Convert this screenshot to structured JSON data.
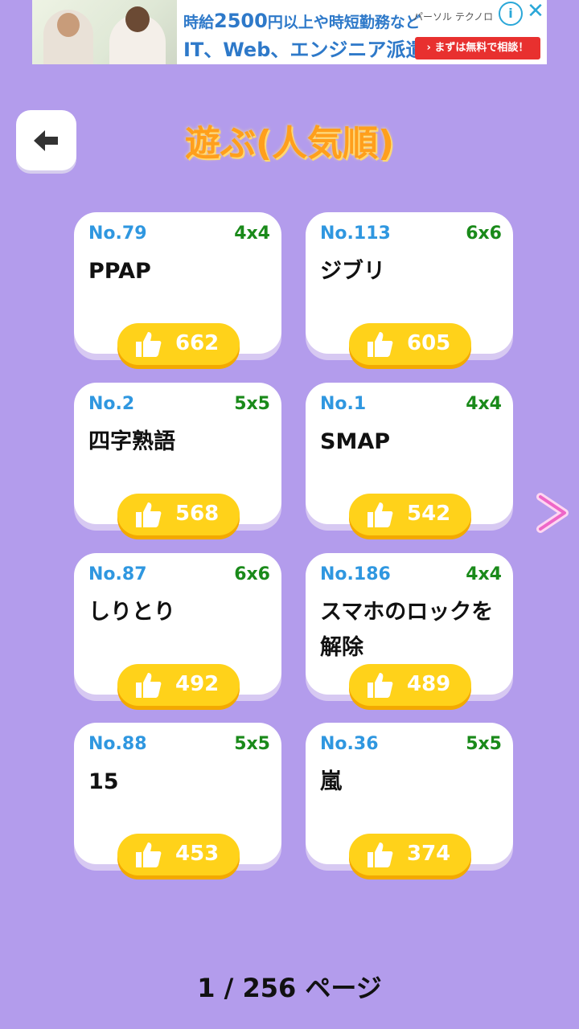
{
  "ad": {
    "line1_prefix": "時給",
    "line1_amount": "2500",
    "line1_suffix": "円以上や時短勤務など",
    "line2": "IT、Web、エンジニア派遣",
    "brand": "パーソル テクノロ",
    "cta": "› まずは無料で相談！",
    "info_icon": "i",
    "close_icon": "✕"
  },
  "header": {
    "title": "遊ぶ(人気順)"
  },
  "cards": [
    {
      "no": "No.79",
      "size": "4x4",
      "name": "PPAP",
      "likes": "662"
    },
    {
      "no": "No.113",
      "size": "6x6",
      "name": "ジブリ",
      "likes": "605"
    },
    {
      "no": "No.2",
      "size": "5x5",
      "name": "四字熟語",
      "likes": "568"
    },
    {
      "no": "No.1",
      "size": "4x4",
      "name": "SMAP",
      "likes": "542"
    },
    {
      "no": "No.87",
      "size": "6x6",
      "name": "しりとり",
      "likes": "492"
    },
    {
      "no": "No.186",
      "size": "4x4",
      "name": "スマホのロックを解除",
      "likes": "489"
    },
    {
      "no": "No.88",
      "size": "5x5",
      "name": "15",
      "likes": "453"
    },
    {
      "no": "No.36",
      "size": "5x5",
      "name": "嵐",
      "likes": "374"
    }
  ],
  "pager": {
    "text": "1 / 256 ページ"
  },
  "colors": {
    "background": "#b39cec",
    "title": "#ff9f1c",
    "number": "#2f97e0",
    "size": "#1a8a1a",
    "like_button": "#ffd21a"
  }
}
